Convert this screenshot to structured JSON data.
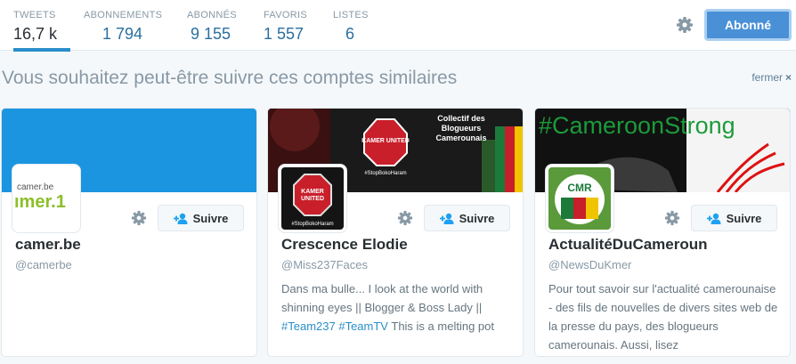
{
  "nav": {
    "stats": [
      {
        "label": "TWEETS",
        "value": "16,7 k",
        "active": true
      },
      {
        "label": "ABONNEMENTS",
        "value": "1 794"
      },
      {
        "label": "ABONNÉS",
        "value": "9 155"
      },
      {
        "label": "FAVORIS",
        "value": "1 557"
      },
      {
        "label": "LISTES",
        "value": "6"
      }
    ],
    "settings_icon": "gear-icon",
    "follow_label": "Abonné",
    "accent": "#4a90d6"
  },
  "suggestions": {
    "title": "Vous souhaitez peut-être suivre ces comptes similaires",
    "dismiss": "fermer",
    "dismiss_icon": "×",
    "follow_label": "Suivre",
    "follow_icon": "add-user-icon",
    "cards": [
      {
        "name": "camer.be",
        "handle": "@camerbe",
        "avatar_text_top": "camer.be",
        "avatar_text_main": "ımer.1"
      },
      {
        "name": "Crescence Elodie",
        "handle": "@Miss237Faces",
        "banner_text": "Collectif des Blogueurs Camerounais",
        "banner_tag": "#StopBokoHaram",
        "avatar_sign": "KAMER UNITED",
        "avatar_tag": "#StopBokoHaram",
        "bio_text": "Dans ma bulle... I look at the world with shinning eyes || Blogger & Boss Lady ||",
        "bio_tag1": "#Team237",
        "bio_tag2": "#TeamTV",
        "bio_rest": "This is a melting pot"
      },
      {
        "name": "ActualitéDuCameroun",
        "handle": "@NewsDuKmer",
        "banner_text": "#CameroonStrong",
        "avatar_text": "CMR",
        "bio": "Pour tout savoir sur l'actualité camerounaise - des fils de nouvelles de divers sites web de la presse du pays, des blogueurs camerounais. Aussi, lisez"
      }
    ]
  }
}
